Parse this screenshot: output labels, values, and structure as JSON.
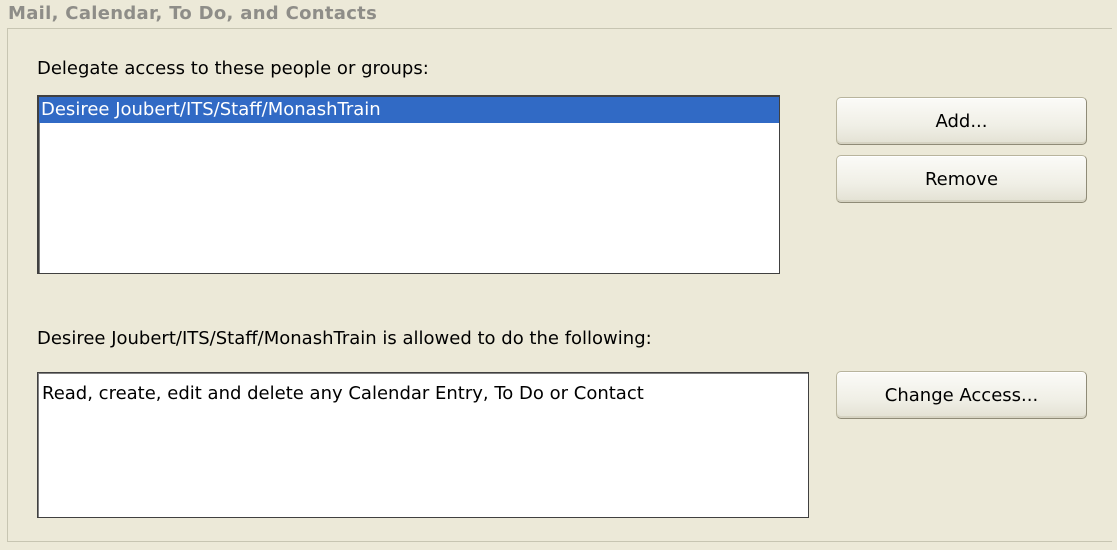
{
  "group": {
    "title": "Mail, Calendar, To Do, and Contacts"
  },
  "delegate": {
    "label": "Delegate access to these people or groups:",
    "items": [
      {
        "name": "Desiree Joubert/ITS/Staff/MonashTrain",
        "selected": true
      }
    ]
  },
  "buttons": {
    "add": "Add...",
    "remove": "Remove",
    "change_access": "Change Access..."
  },
  "permissions": {
    "label": "Desiree Joubert/ITS/Staff/MonashTrain is allowed to do the following:",
    "text": "Read, create, edit and delete any Calendar Entry, To Do or Contact"
  },
  "colors": {
    "selection": "#316ac5",
    "window_bg": "#ece9d8",
    "group_title": "#8e8d88"
  }
}
